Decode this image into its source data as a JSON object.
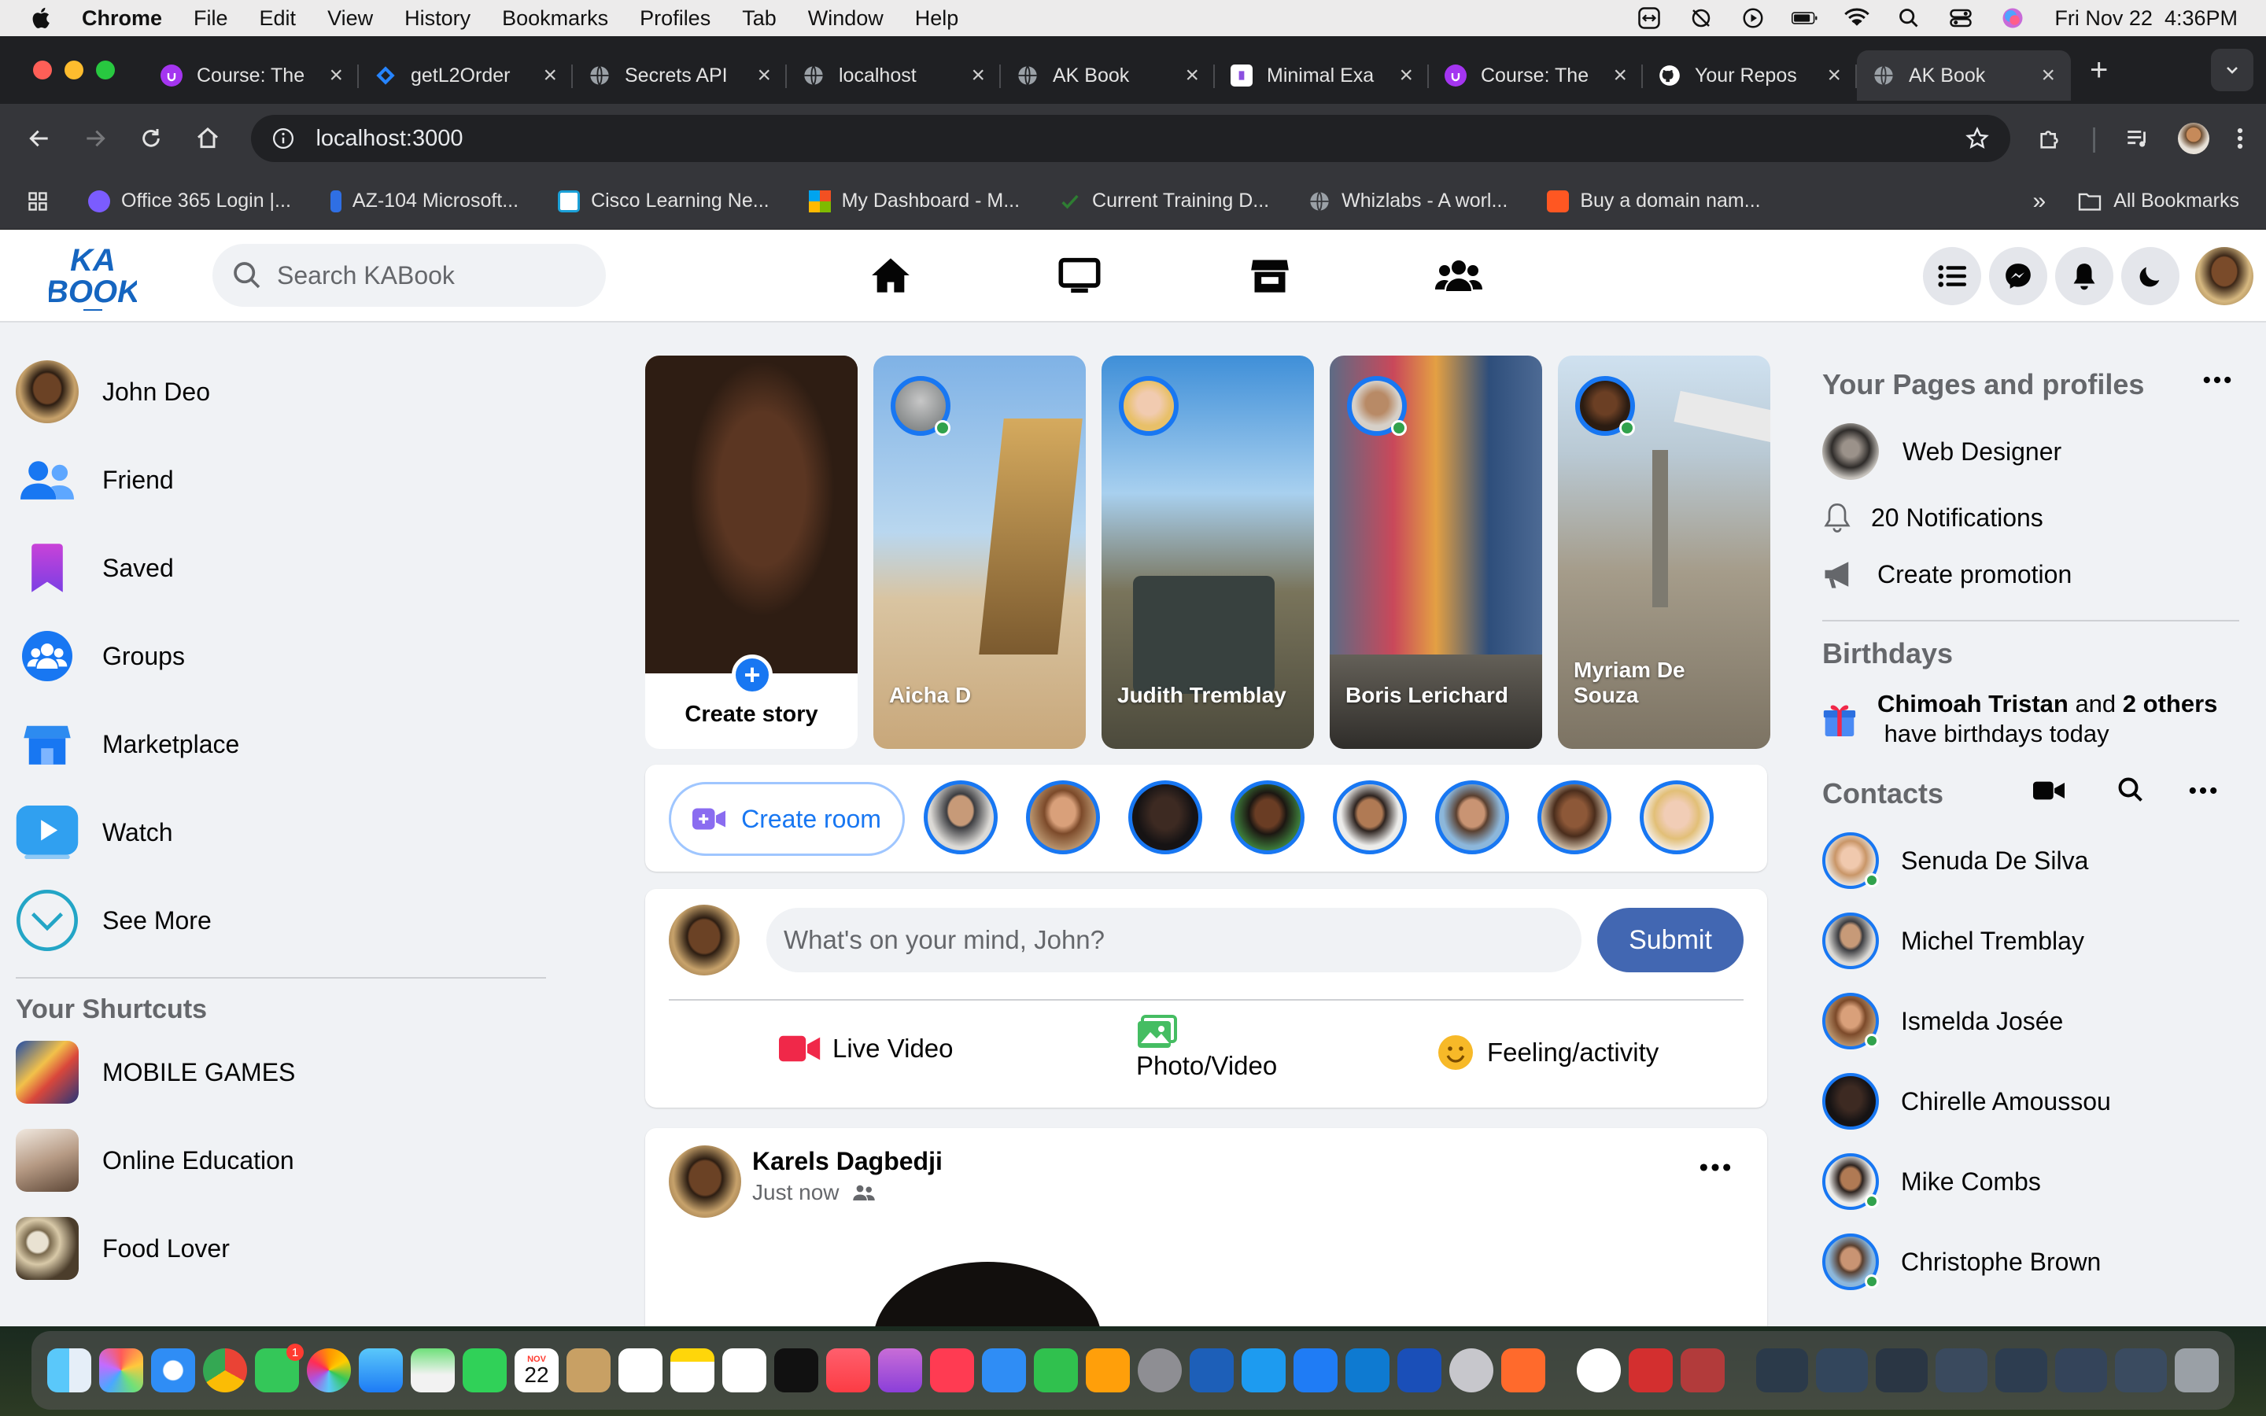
{
  "menubar": {
    "app": "Chrome",
    "items": [
      "File",
      "Edit",
      "View",
      "History",
      "Bookmarks",
      "Profiles",
      "Tab",
      "Window",
      "Help"
    ],
    "datetime": "Fri Nov 22  4:36PM"
  },
  "tabs": [
    {
      "title": "Course: The",
      "icon": "udemy-icon",
      "color": "#a435f0"
    },
    {
      "title": "getL2Order",
      "icon": "jira-icon",
      "color": "#2684ff"
    },
    {
      "title": "Secrets API",
      "icon": "globe-icon",
      "color": "#9aa0a6"
    },
    {
      "title": "localhost",
      "icon": "globe-icon",
      "color": "#9aa0a6"
    },
    {
      "title": "AK Book",
      "icon": "globe-icon",
      "color": "#9aa0a6"
    },
    {
      "title": "Minimal Exa",
      "icon": "doc-icon",
      "color": "#8b4fe0"
    },
    {
      "title": "Course: The",
      "icon": "udemy-icon",
      "color": "#a435f0"
    },
    {
      "title": "Your Repos",
      "icon": "github-icon",
      "color": "#ffffff"
    },
    {
      "title": "AK Book",
      "icon": "globe-icon",
      "color": "#9aa0a6",
      "active": true
    }
  ],
  "url": "localhost:3000",
  "bookmarks": [
    {
      "label": "Office 365 Login |...",
      "color": "#7b5cff"
    },
    {
      "label": "AZ-104 Microsoft...",
      "color": "#2f6fe4"
    },
    {
      "label": "Cisco Learning Ne...",
      "color": "#1ba0d7"
    },
    {
      "label": "My Dashboard - M...",
      "color": "#f25022"
    },
    {
      "label": "Current Training D...",
      "color": "#2e7d32"
    },
    {
      "label": "Whizlabs - A worl...",
      "color": "#9aa0a6"
    },
    {
      "label": "Buy a domain nam...",
      "color": "#ff5722"
    }
  ],
  "all_bookmarks": "All Bookmarks",
  "app": {
    "logo_top": "KA",
    "logo_bottom": "BOOK",
    "search_placeholder": "Search KABook",
    "brand_color": "#1877f2"
  },
  "left_menu": [
    {
      "label": "John Deo",
      "icon": "profile-avatar"
    },
    {
      "label": "Friend",
      "icon": "friends-icon"
    },
    {
      "label": "Saved",
      "icon": "bookmark-icon"
    },
    {
      "label": "Groups",
      "icon": "groups-icon"
    },
    {
      "label": "Marketplace",
      "icon": "store-icon"
    },
    {
      "label": "Watch",
      "icon": "play-icon"
    },
    {
      "label": "See More",
      "icon": "chevron-down-icon"
    }
  ],
  "shortcuts_title": "Your Shurtcuts",
  "shortcuts": [
    {
      "label": "MOBILE GAMES"
    },
    {
      "label": "Online Education"
    },
    {
      "label": "Food Lover"
    }
  ],
  "stories": {
    "create_label": "Create story",
    "items": [
      {
        "name": "Aicha D"
      },
      {
        "name": "Judith Tremblay"
      },
      {
        "name": "Boris Lerichard"
      },
      {
        "name": "Myriam De Souza"
      }
    ]
  },
  "rooms": {
    "create_label": "Create room"
  },
  "composer": {
    "placeholder": "What's on your mind, John?",
    "submit": "Submit",
    "actions": [
      "Live Video",
      "Photo/Video",
      "Feeling/activity"
    ]
  },
  "post": {
    "author": "Karels Dagbedji",
    "time": "Just now"
  },
  "right": {
    "pages_title": "Your Pages and profiles",
    "page_name": "Web Designer",
    "notifications": "20 Notifications",
    "promotion": "Create promotion",
    "birthdays_title": "Birthdays",
    "birthday_name": "Chimoah Tristan",
    "birthday_and": " and ",
    "birthday_count": "2 others",
    "birthday_rest": " have birthdays today",
    "contacts_title": "Contacts",
    "contacts": [
      {
        "name": "Senuda De Silva"
      },
      {
        "name": "Michel Tremblay"
      },
      {
        "name": "Ismelda Josée"
      },
      {
        "name": "Chirelle Amoussou"
      },
      {
        "name": "Mike Combs"
      },
      {
        "name": "Christophe Brown"
      }
    ]
  },
  "dock": {
    "calendar_day": "22",
    "calendar_month": "NOV",
    "messages_badge": "1"
  }
}
